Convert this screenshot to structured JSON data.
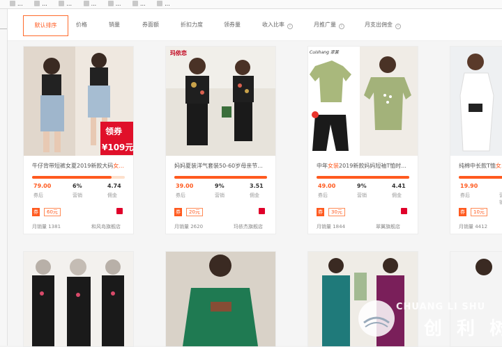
{
  "browser_bar": {
    "items": [
      "...",
      "...",
      "...",
      "...",
      "...",
      "...",
      "..."
    ]
  },
  "sort_tabs": [
    {
      "label": "默认排序",
      "active": true
    },
    {
      "label": "价格",
      "info": false
    },
    {
      "label": "销量",
      "info": false
    },
    {
      "label": "券面额",
      "info": false
    },
    {
      "label": "折扣力度",
      "info": false
    },
    {
      "label": "领券量",
      "info": false
    },
    {
      "label": "收入比率",
      "info": true
    },
    {
      "label": "月推广量",
      "info": true
    },
    {
      "label": "月支出佣金",
      "info": true
    }
  ],
  "stat_labels": {
    "price": "券后",
    "rate": "营销",
    "commission": "佣金"
  },
  "products": [
    {
      "title_before": "牛仔背带短裤女夏2019新款大码",
      "title_highlight": "女...",
      "price": "79.00",
      "rate": "6%",
      "commission": "4.74",
      "coupon_tag": "券",
      "coupon_value": "60元",
      "progress": 0.86,
      "sales": "月销量 1381",
      "shop": "和风岛旗舰店",
      "promo_badge": "领券",
      "promo_price": "¥109元"
    },
    {
      "title_before": "妈妈夏装洋气套装50-60岁母亲节...",
      "title_highlight": "",
      "price": "39.00",
      "rate": "9%",
      "commission": "3.51",
      "coupon_tag": "券",
      "coupon_value": "20元",
      "progress": 1.0,
      "sales": "月销量 2620",
      "shop": "玛依杰旗舰店",
      "brand": "玛依恋"
    },
    {
      "title_before": "中年",
      "title_highlight": "女装",
      "title_after": "2019新款妈妈短袖T恤时...",
      "price": "49.00",
      "rate": "9%",
      "commission": "4.41",
      "coupon_tag": "券",
      "coupon_value": "30元",
      "progress": 1.0,
      "sales": "月销量 1844",
      "shop": "翠翼旗舰店",
      "brand": "Cuishang 翠裳"
    },
    {
      "title_before": "纯棉中长款T恤",
      "title_highlight": "女...",
      "price": "19.90",
      "rate": "",
      "commission": "",
      "coupon_tag": "券",
      "coupon_value": "10元",
      "progress": 1.0,
      "sales": "月销量 4412",
      "shop": ""
    }
  ],
  "watermark": {
    "latin": "CHUANG LI SHU",
    "chinese": "创 利 树"
  },
  "colors": {
    "accent": "#ff5a1f",
    "progress_bg": "#fde0cc",
    "tmall": "#e0002a"
  }
}
